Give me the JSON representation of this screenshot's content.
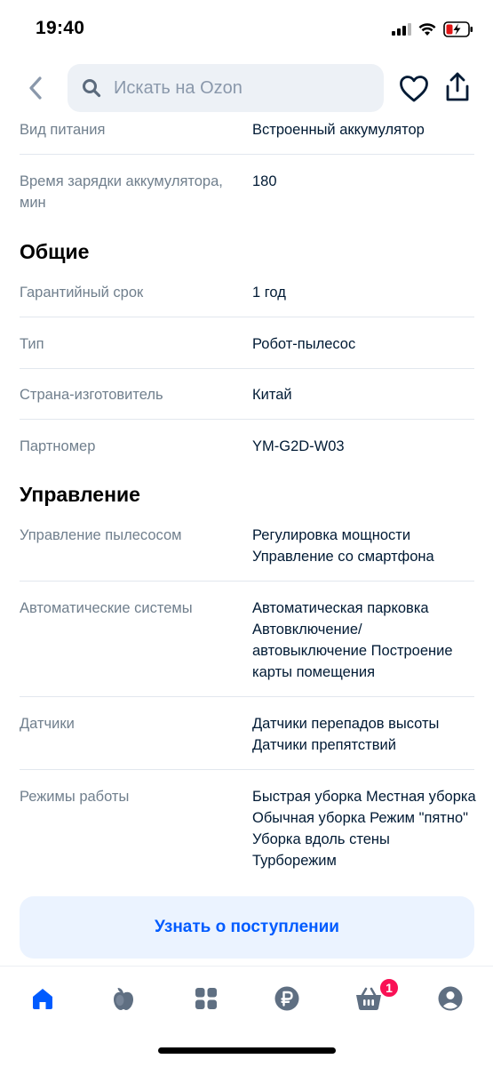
{
  "status": {
    "time": "19:40"
  },
  "search": {
    "placeholder": "Искать на Ozon"
  },
  "specs": {
    "power_type": {
      "label": "Вид питания",
      "value": "Встроенный аккумулятор"
    },
    "charge_time": {
      "label": "Время зарядки аккумулятора, мин",
      "value": "180"
    },
    "general_title": "Общие",
    "warranty": {
      "label": "Гарантийный срок",
      "value": "1 год"
    },
    "type": {
      "label": "Тип",
      "value": "Робот-пылесос"
    },
    "country": {
      "label": "Страна-изготовитель",
      "value": "Китай"
    },
    "part_number": {
      "label": "Партномер",
      "value": "YM-G2D-W03"
    },
    "control_title": "Управление",
    "vacuum_control": {
      "label": "Управление пылесосом",
      "value": "Регулировка мощности Управление со смартфона"
    },
    "auto_systems": {
      "label": "Автоматические системы",
      "value": "Автоматическая парковка Автовключение/автовыключение Построение карты помещения"
    },
    "sensors": {
      "label": "Датчики",
      "value": "Датчики перепадов высоты Датчики препятствий"
    },
    "modes": {
      "label": "Режимы работы",
      "value": "Быстрая уборка Местная уборка Обычная уборка Режим \"пятно\" Уборка вдоль стены Турборежим"
    }
  },
  "notify_button": {
    "label": "Узнать о поступлении"
  },
  "tabbar": {
    "cart_badge": "1"
  },
  "colors": {
    "accent": "#005bff",
    "badge": "#f91155",
    "label": "#707f8d",
    "text": "#001a34"
  }
}
